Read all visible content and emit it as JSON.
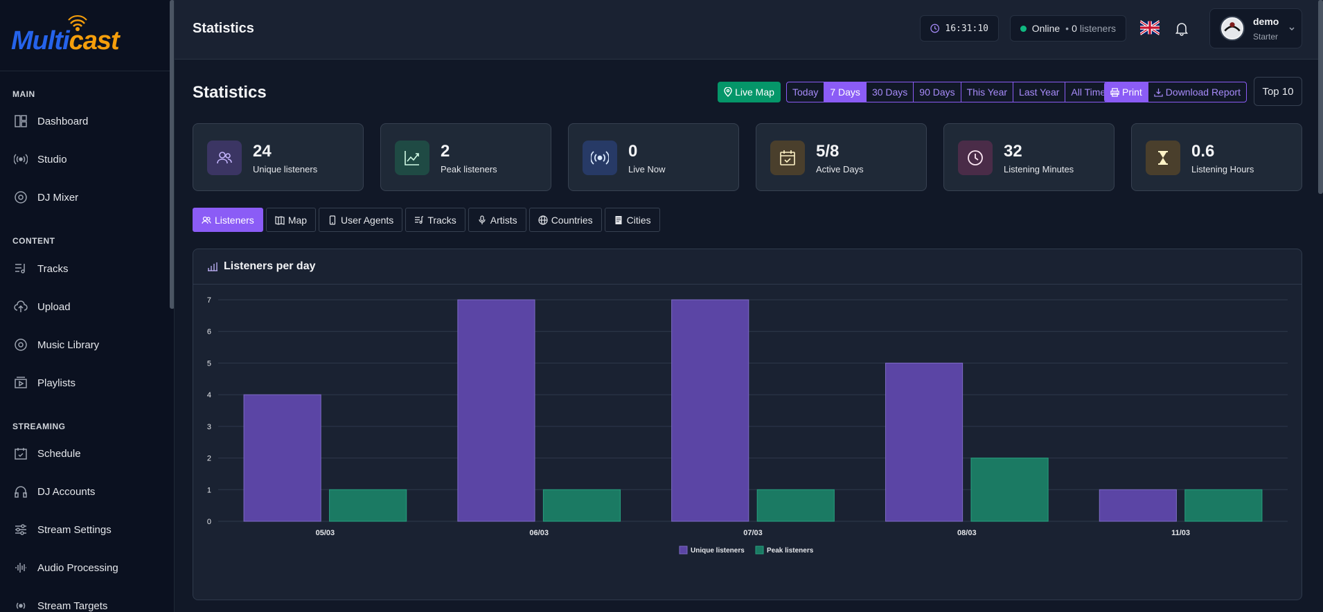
{
  "app": {
    "logo_main": "Multi",
    "logo_accent": "cast"
  },
  "sidebar": {
    "sections": [
      {
        "title": "MAIN",
        "items": [
          "Dashboard",
          "Studio",
          "DJ Mixer"
        ]
      },
      {
        "title": "CONTENT",
        "items": [
          "Tracks",
          "Upload",
          "Music Library",
          "Playlists"
        ]
      },
      {
        "title": "STREAMING",
        "items": [
          "Schedule",
          "DJ Accounts",
          "Stream Settings",
          "Audio Processing",
          "Stream Targets"
        ]
      }
    ]
  },
  "topbar": {
    "title": "Statistics",
    "clock": "16:31:10",
    "status": "Online",
    "listeners_count": "0",
    "listeners_label": "listeners",
    "user_name": "demo",
    "user_plan": "Starter"
  },
  "page": {
    "title": "Statistics",
    "live_map_label": "Live Map",
    "ranges": [
      "Today",
      "7 Days",
      "30 Days",
      "90 Days",
      "This Year",
      "Last Year",
      "All Time"
    ],
    "active_range": "7 Days",
    "print_label": "Print",
    "download_label": "Download Report",
    "top10_label": "Top 10"
  },
  "stats": [
    {
      "value": "24",
      "label": "Unique listeners",
      "icon": "users-icon",
      "bg": "#3b3563",
      "fg": "#c4b5fd"
    },
    {
      "value": "2",
      "label": "Peak listeners",
      "icon": "trend-up-icon",
      "bg": "#1f4a44",
      "fg": "#d1fae5"
    },
    {
      "value": "0",
      "label": "Live Now",
      "icon": "broadcast-icon",
      "bg": "#273a66",
      "fg": "#dbeafe"
    },
    {
      "value": "5/8",
      "label": "Active Days",
      "icon": "calendar-check-icon",
      "bg": "#4a3f2c",
      "fg": "#fef3c7"
    },
    {
      "value": "32",
      "label": "Listening Minutes",
      "icon": "clock-icon",
      "bg": "#4a2c48",
      "fg": "#fce7f3"
    },
    {
      "value": "0.6",
      "label": "Listening Hours",
      "icon": "hourglass-icon",
      "bg": "#4a3f2c",
      "fg": "#fef3c7"
    }
  ],
  "tabs": [
    "Listeners",
    "Map",
    "User Agents",
    "Tracks",
    "Artists",
    "Countries",
    "Cities"
  ],
  "active_tab": "Listeners",
  "panel_title": "Listeners per day",
  "chart_data": {
    "type": "bar",
    "categories": [
      "05/03",
      "06/03",
      "07/03",
      "08/03",
      "11/03"
    ],
    "series": [
      {
        "name": "Unique listeners",
        "values": [
          4,
          7,
          7,
          5,
          1
        ],
        "color": "#5b45a5"
      },
      {
        "name": "Peak listeners",
        "values": [
          1,
          1,
          1,
          2,
          1
        ],
        "color": "#1b7a63"
      }
    ],
    "yticks": [
      0,
      1,
      2,
      3,
      4,
      5,
      6,
      7
    ],
    "ylim": [
      0,
      7
    ],
    "grid": true,
    "legend": "bottom"
  }
}
